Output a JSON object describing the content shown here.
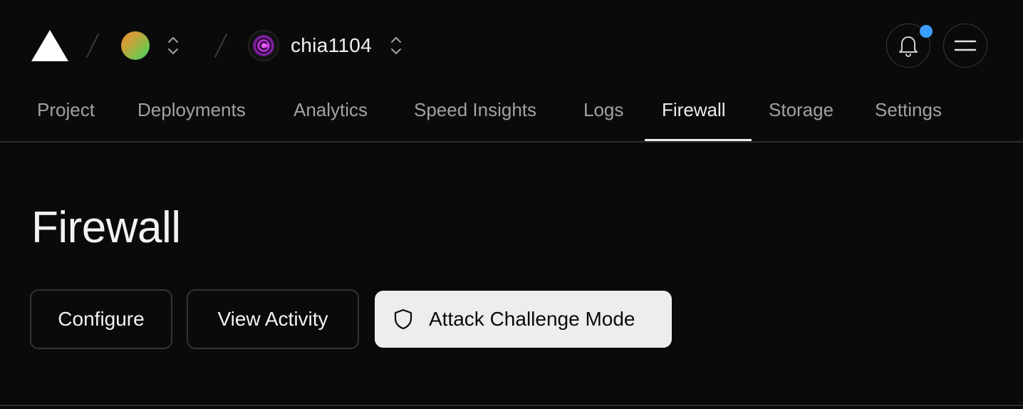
{
  "header": {
    "project_name": "chia1104",
    "icons": {
      "logo": "vercel-triangle-logo",
      "team_switcher": "chevron-up-down-icon",
      "project_switcher": "chevron-up-down-icon",
      "notifications": "bell-icon",
      "menu": "hamburger-menu-icon"
    },
    "notification_dot_color": "#3b9eff"
  },
  "tabs": [
    {
      "label": "Project",
      "active": false
    },
    {
      "label": "Deployments",
      "active": false
    },
    {
      "label": "Analytics",
      "active": false
    },
    {
      "label": "Speed Insights",
      "active": false
    },
    {
      "label": "Logs",
      "active": false
    },
    {
      "label": "Firewall",
      "active": true
    },
    {
      "label": "Storage",
      "active": false
    },
    {
      "label": "Settings",
      "active": false
    }
  ],
  "main": {
    "title": "Firewall",
    "buttons": {
      "configure": "Configure",
      "view_activity": "View Activity",
      "attack_challenge_mode": "Attack Challenge Mode"
    },
    "attack_icon": "shield-icon"
  },
  "colors": {
    "background": "#0a0a0a",
    "text_primary": "#ededed",
    "text_muted": "#a1a1a1",
    "border": "#333333",
    "accent_dot": "#3b9eff"
  }
}
